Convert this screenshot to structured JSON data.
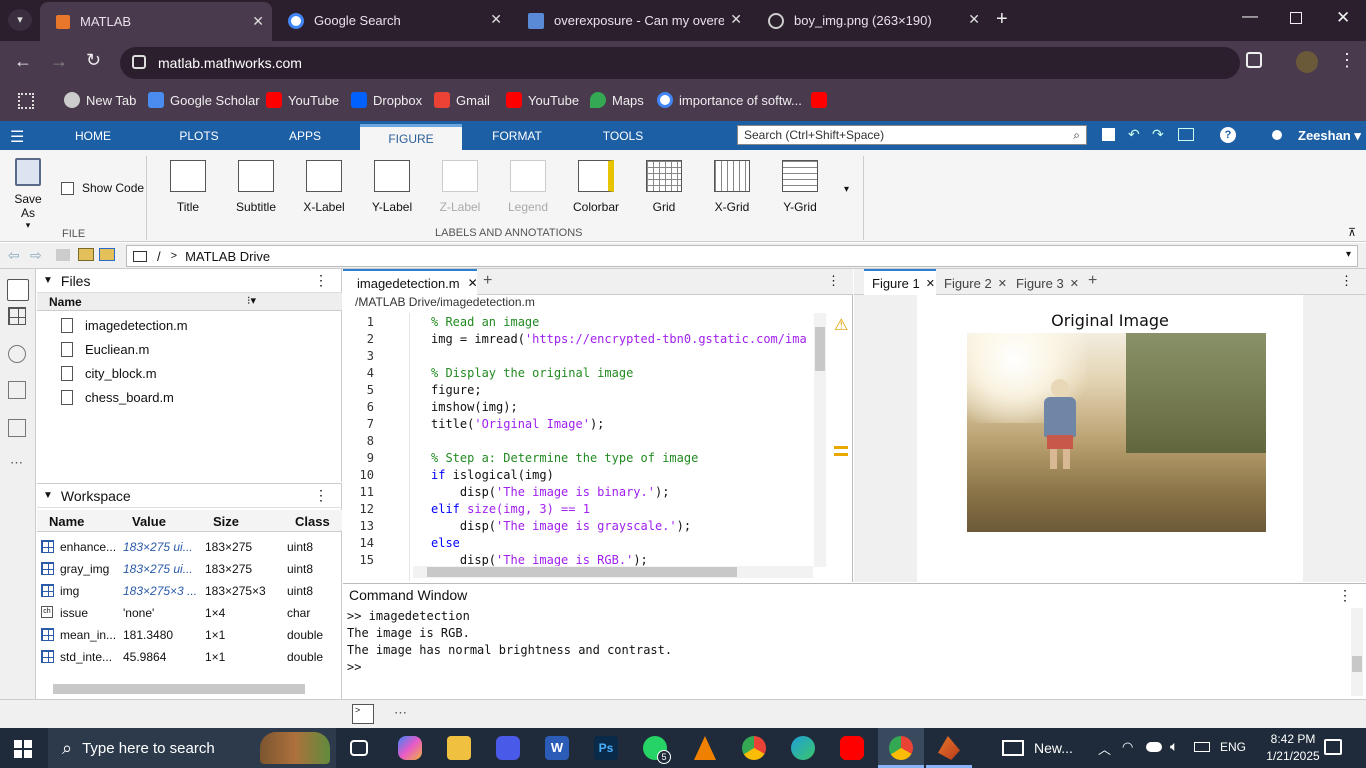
{
  "browser": {
    "tabs": [
      {
        "title": "MATLAB"
      },
      {
        "title": "Google Search"
      },
      {
        "title": "overexposure - Can my overexp"
      },
      {
        "title": "boy_img.png (263×190)"
      }
    ],
    "url": "matlab.mathworks.com",
    "bookmarks": [
      "New Tab",
      "Google Scholar",
      "YouTube",
      "Dropbox",
      "Gmail",
      "YouTube",
      "Maps",
      "importance of softw..."
    ]
  },
  "toolstrip": {
    "tabs": [
      "HOME",
      "PLOTS",
      "APPS",
      "FIGURE",
      "FORMAT",
      "TOOLS"
    ],
    "search_placeholder": "Search (Ctrl+Shift+Space)",
    "user": "Zeeshan"
  },
  "ribbon": {
    "save_as": "Save As",
    "show_code": "Show Code",
    "file_group": "FILE",
    "buttons": [
      "Title",
      "Subtitle",
      "X-Label",
      "Y-Label",
      "Z-Label",
      "Legend",
      "Colorbar",
      "Grid",
      "X-Grid",
      "Y-Grid"
    ],
    "group_label": "LABELS AND ANNOTATIONS"
  },
  "address": {
    "root": "/",
    "sep": ">",
    "folder": "MATLAB Drive"
  },
  "files": {
    "title": "Files",
    "column": "Name",
    "items": [
      "imagedetection.m",
      "Eucliean.m",
      "city_block.m",
      "chess_board.m"
    ]
  },
  "workspace": {
    "title": "Workspace",
    "columns": [
      "Name",
      "Value",
      "Size",
      "Class"
    ],
    "rows": [
      {
        "name": "enhance...",
        "value": "183×275 ui...",
        "size": "183×275",
        "class": "uint8"
      },
      {
        "name": "gray_img",
        "value": "183×275 ui...",
        "size": "183×275",
        "class": "uint8"
      },
      {
        "name": "img",
        "value": "183×275×3 ...",
        "size": "183×275×3",
        "class": "uint8"
      },
      {
        "name": "issue",
        "value": "'none'",
        "size": "1×4",
        "class": "char"
      },
      {
        "name": "mean_in...",
        "value": "181.3480",
        "size": "1×1",
        "class": "double"
      },
      {
        "name": "std_inte...",
        "value": "45.9864",
        "size": "1×1",
        "class": "double"
      }
    ]
  },
  "editor": {
    "tab": "imagedetection.m",
    "path": "/MATLAB Drive/imagedetection.m",
    "lines": [
      {
        "n": "1",
        "parts": [
          {
            "c": "cm",
            "t": "% Read an image"
          }
        ]
      },
      {
        "n": "2",
        "parts": [
          {
            "c": "",
            "t": "img = imread("
          },
          {
            "c": "st",
            "t": "'https://encrypted-tbn0.gstatic.com/ima"
          }
        ]
      },
      {
        "n": "3",
        "parts": []
      },
      {
        "n": "4",
        "parts": [
          {
            "c": "cm",
            "t": "% Display the original image"
          }
        ]
      },
      {
        "n": "5",
        "parts": [
          {
            "c": "",
            "t": "figure;"
          }
        ]
      },
      {
        "n": "6",
        "parts": [
          {
            "c": "",
            "t": "imshow(img);"
          }
        ]
      },
      {
        "n": "7",
        "parts": [
          {
            "c": "",
            "t": "title("
          },
          {
            "c": "st",
            "t": "'Original Image'"
          },
          {
            "c": "",
            "t": ");"
          }
        ]
      },
      {
        "n": "8",
        "parts": []
      },
      {
        "n": "9",
        "parts": [
          {
            "c": "cm",
            "t": "% Step a: Determine the type of image"
          }
        ]
      },
      {
        "n": "10",
        "parts": [
          {
            "c": "kw",
            "t": "if"
          },
          {
            "c": "",
            "t": " islogical(img)"
          }
        ]
      },
      {
        "n": "11",
        "parts": [
          {
            "c": "",
            "t": "    disp("
          },
          {
            "c": "st",
            "t": "'The image is binary.'"
          },
          {
            "c": "",
            "t": ");"
          }
        ]
      },
      {
        "n": "12",
        "parts": [
          {
            "c": "kw",
            "t": "elif"
          },
          {
            "c": "",
            "t": " "
          },
          {
            "c": "st",
            "t": "size(img, 3) == 1"
          }
        ]
      },
      {
        "n": "13",
        "parts": [
          {
            "c": "",
            "t": "    disp("
          },
          {
            "c": "st",
            "t": "'The image is grayscale.'"
          },
          {
            "c": "",
            "t": ");"
          }
        ]
      },
      {
        "n": "14",
        "parts": [
          {
            "c": "kw",
            "t": "else"
          }
        ]
      },
      {
        "n": "15",
        "parts": [
          {
            "c": "",
            "t": "    disp("
          },
          {
            "c": "st",
            "t": "'The image is RGB.'"
          },
          {
            "c": "",
            "t": ");"
          }
        ]
      }
    ]
  },
  "figures": {
    "tabs": [
      "Figure 1",
      "Figure 2",
      "Figure 3"
    ],
    "title": "Original Image"
  },
  "command": {
    "title": "Command Window",
    "lines": [
      ">> imagedetection",
      "The image is RGB.",
      "The image has normal brightness and contrast.",
      ">>"
    ]
  },
  "taskbar": {
    "search": "Type here to search",
    "news": "New...",
    "lang": "ENG",
    "time": "8:42 PM",
    "date": "1/21/2025",
    "whatsapp_badge": "5"
  },
  "colors": {
    "matlab_blue": "#1c5fa5",
    "chrome_dark": "#2b1f2e",
    "chrome_mid": "#4a3a4d",
    "comment": "#228b22",
    "string": "#a020f0",
    "keyword": "#0000ff"
  }
}
